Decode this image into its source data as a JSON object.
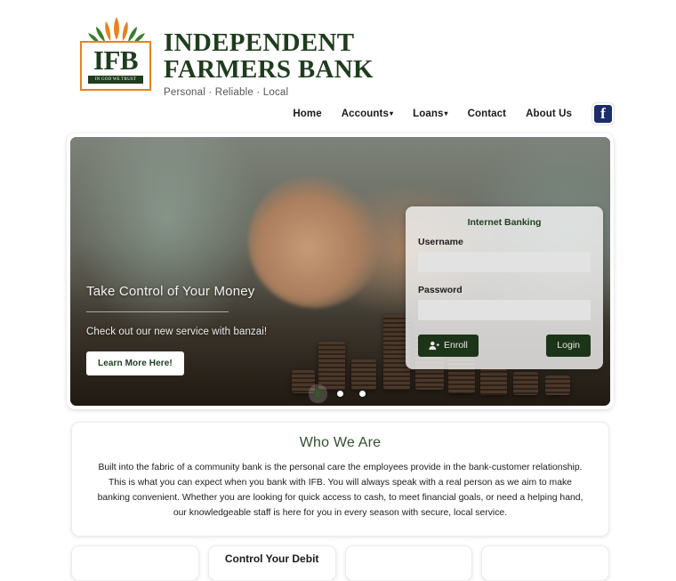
{
  "header": {
    "logo": {
      "mark_text": "IFB",
      "motto": "IN GOD WE TRUST",
      "name_line1": "INDEPENDENT",
      "name_line2": "FARMERS BANK",
      "tagline": "Personal · Reliable · Local",
      "colors": {
        "green": "#1e3d1c",
        "orange": "#e8821e"
      }
    },
    "nav": [
      {
        "label": "Home",
        "caret": ""
      },
      {
        "label": "Accounts",
        "caret": "▾"
      },
      {
        "label": "Loans",
        "caret": "▾"
      },
      {
        "label": "Contact",
        "caret": ""
      },
      {
        "label": "About Us",
        "caret": ""
      }
    ],
    "social": {
      "facebook_glyph": "f",
      "facebook_color": "#1c2d6b"
    }
  },
  "hero": {
    "title": "Take Control of Your Money",
    "subtitle": "Check out our new service with banzai!",
    "button_label": "Learn More Here!",
    "slides_total": 3,
    "active_slide": 1
  },
  "login": {
    "title": "Internet Banking",
    "username_label": "Username",
    "username_value": "",
    "username_placeholder": "",
    "password_label": "Password",
    "password_value": "",
    "password_placeholder": "",
    "enroll_label": "Enroll",
    "login_label": "Login",
    "button_color": "#1c3418"
  },
  "about": {
    "title": "Who We Are",
    "title_color": "#33502f",
    "body": "Built into the fabric of a community bank is the personal care the employees provide in the bank-customer relationship. This is what you can expect when you bank with IFB. You will always speak with a real person as we aim to make banking convenient. Whether you are looking for quick access to cash, to meet financial goals, or need a helping hand, our knowledgeable staff is here for you in every season with secure, local service."
  },
  "bottom_cards": [
    {
      "title": ""
    },
    {
      "title": "Control Your Debit"
    },
    {
      "title": ""
    },
    {
      "title": ""
    }
  ]
}
